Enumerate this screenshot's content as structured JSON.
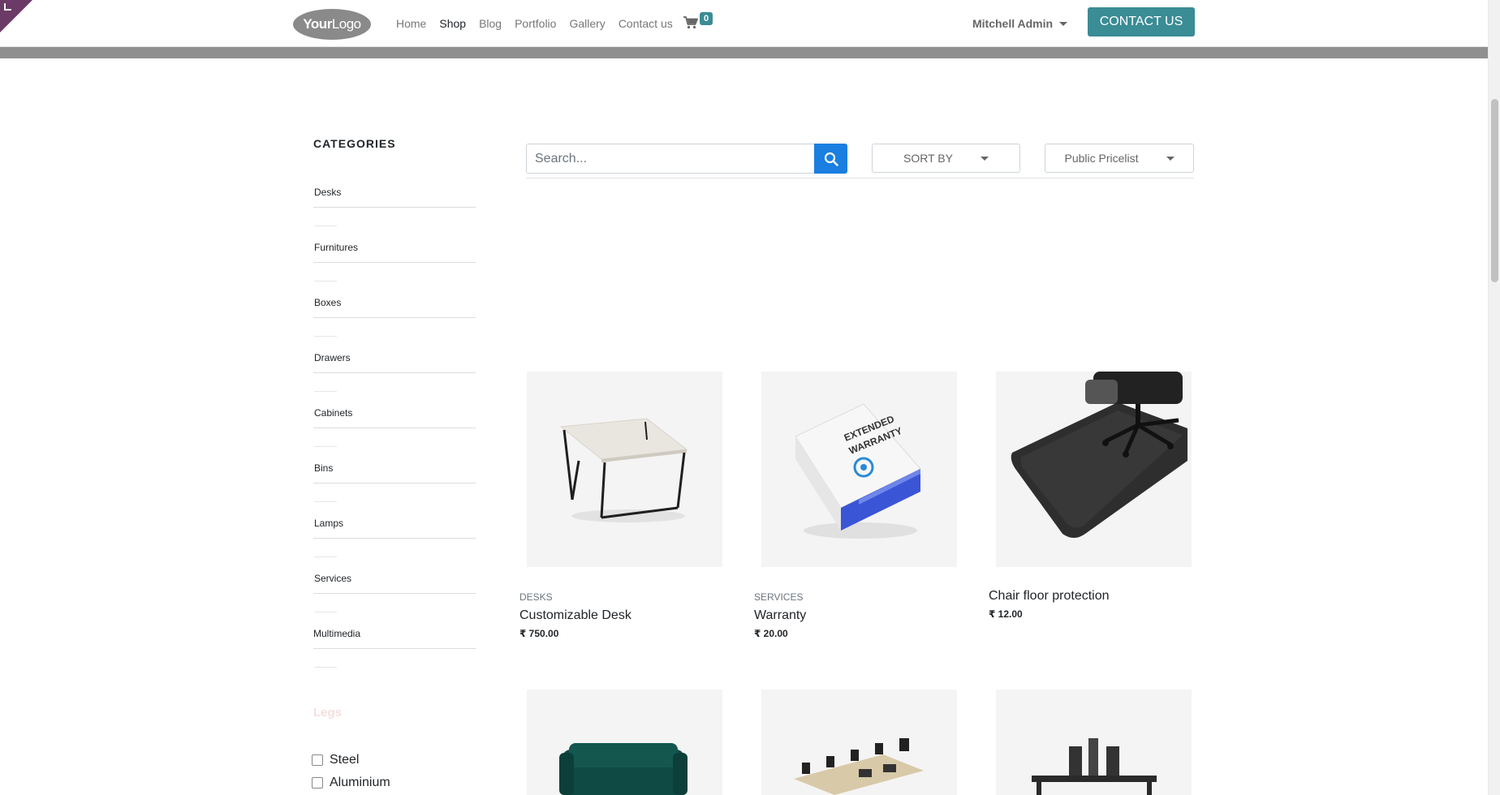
{
  "header": {
    "logo_text_bold": "Your",
    "logo_text_light": "Logo",
    "nav": [
      {
        "label": "Home"
      },
      {
        "label": "Shop"
      },
      {
        "label": "Blog"
      },
      {
        "label": "Portfolio"
      },
      {
        "label": "Gallery"
      },
      {
        "label": "Contact us"
      }
    ],
    "active_nav": "Shop",
    "cart_count": "0",
    "user_name": "Mitchell Admin",
    "contact_button": "CONTACT US"
  },
  "sidebar": {
    "title": "CATEGORIES",
    "categories": [
      {
        "label": "Desks"
      },
      {
        "label": "Furnitures"
      },
      {
        "label": "Boxes"
      },
      {
        "label": "Drawers"
      },
      {
        "label": "Cabinets"
      },
      {
        "label": "Bins"
      },
      {
        "label": "Lamps"
      },
      {
        "label": "Services"
      },
      {
        "label": "Multimedia"
      }
    ],
    "attribute_title": "Legs",
    "attribute_values": [
      {
        "label": "Steel",
        "checked": false
      },
      {
        "label": "Aluminium",
        "checked": false
      }
    ]
  },
  "toolbar": {
    "search_placeholder": "Search...",
    "sort_label": "SORT BY",
    "pricelist_label": "Public Pricelist"
  },
  "products": [
    {
      "category": "DESKS",
      "name": "Customizable Desk",
      "price": "₹ 750.00",
      "image_icon": "desk-image"
    },
    {
      "category": "SERVICES",
      "name": "Warranty",
      "price": "₹ 20.00",
      "image_icon": "warranty-box-image"
    },
    {
      "category": "",
      "name": "Chair floor protection",
      "price": "₹ 12.00",
      "image_icon": "chair-mat-image"
    },
    {
      "category": "",
      "name": "",
      "price": "",
      "image_icon": "sofa-image"
    },
    {
      "category": "",
      "name": "",
      "price": "",
      "image_icon": "office-desks-image"
    },
    {
      "category": "",
      "name": "",
      "price": "",
      "image_icon": "workstation-image"
    }
  ],
  "colors": {
    "accent": "#3a8c95",
    "search_button": "#1a7fe0",
    "edit_corner": "#6b3a66"
  }
}
